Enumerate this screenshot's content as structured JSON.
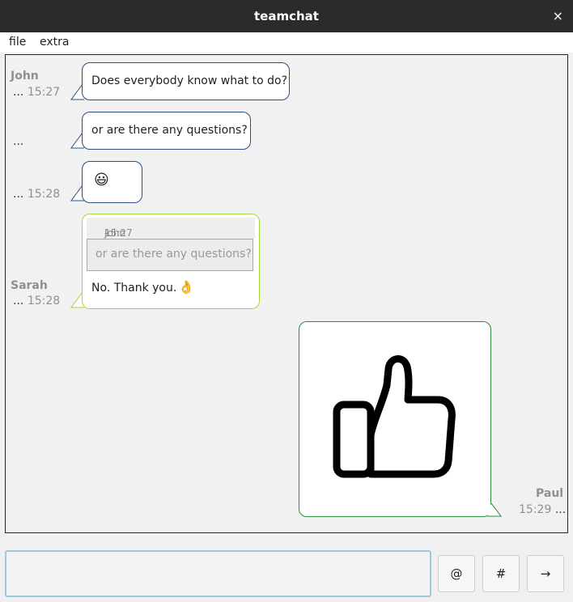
{
  "window": {
    "title": "teamchat",
    "close_label": "×"
  },
  "menu": [
    {
      "label": "file"
    },
    {
      "label": "extra"
    }
  ],
  "messages": [
    {
      "sender": "John",
      "meta_dots": "...",
      "time": "15:27",
      "text": "Does everybody know what to do?"
    },
    {
      "meta_dots": "...",
      "text": "or are there any questions?"
    },
    {
      "meta_dots": "...",
      "time": "15:28",
      "emoji": "😃"
    },
    {
      "sender": "Sarah",
      "meta_dots": "...",
      "time": "15:28",
      "quote": {
        "time": "15:27",
        "separator": "-",
        "author": "John",
        "text": "or are there any questions?"
      },
      "text": "No. Thank you.",
      "emoji": "👌"
    },
    {
      "sender": "Paul",
      "time": "15:29",
      "meta_dots": "...",
      "image_icon": "thumbs-up-icon"
    }
  ],
  "composer": {
    "buttons": [
      {
        "label": "@"
      },
      {
        "label": "#"
      },
      {
        "label": "→"
      }
    ]
  },
  "colors": {
    "john_border": "#2a4f8a",
    "sarah_border": "#a7d63b",
    "paul_border": "#2e8b3a"
  }
}
